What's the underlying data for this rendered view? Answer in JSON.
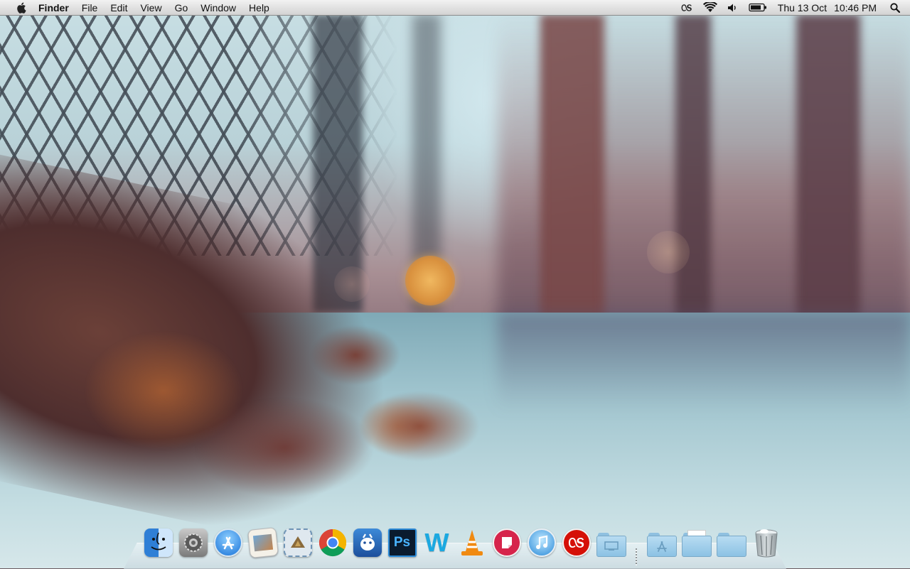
{
  "menubar": {
    "app_name": "Finder",
    "menus": [
      "File",
      "Edit",
      "View",
      "Go",
      "Window",
      "Help"
    ],
    "status_icons": [
      "lastfm-scrobbler-icon",
      "wifi-icon",
      "volume-icon",
      "battery-icon"
    ],
    "clock": {
      "date": "Thu 13 Oct",
      "time": "10:46 PM"
    }
  },
  "dock": {
    "apps": [
      {
        "icon": "finder-icon"
      },
      {
        "icon": "system-preferences-icon"
      },
      {
        "icon": "app-store-icon"
      },
      {
        "icon": "preview-icon"
      },
      {
        "icon": "mail-icon"
      },
      {
        "icon": "chrome-icon"
      },
      {
        "icon": "adium-icon"
      },
      {
        "icon": "photoshop-icon",
        "glyph": "Ps"
      },
      {
        "icon": "word-icon",
        "glyph": "W"
      },
      {
        "icon": "vlc-icon"
      },
      {
        "icon": "sticky-note-app-icon"
      },
      {
        "icon": "itunes-icon"
      },
      {
        "icon": "lastfm-icon"
      }
    ],
    "stacks": [
      {
        "icon": "desktop-folder-icon"
      },
      {
        "icon": "applications-folder-icon"
      },
      {
        "icon": "documents-folder-icon"
      },
      {
        "icon": "downloads-folder-icon"
      },
      {
        "icon": "trash-icon"
      }
    ]
  }
}
